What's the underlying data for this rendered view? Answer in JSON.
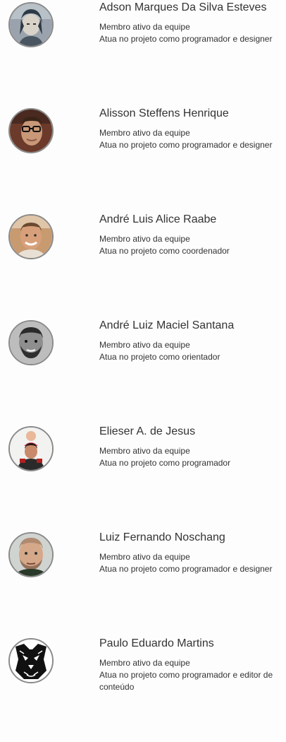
{
  "members": [
    {
      "name": "Adson Marques Da Silva Esteves",
      "status": "Membro ativo da equipe",
      "role": "Atua no projeto como programador e designer",
      "avatar_icon": "anime-avatar-icon"
    },
    {
      "name": "Alisson Steffens Henrique",
      "status": "Membro ativo da equipe",
      "role": "Atua no projeto como programador e designer",
      "avatar_icon": "person-glasses-avatar-icon"
    },
    {
      "name": "André Luis Alice Raabe",
      "status": "Membro ativo da equipe",
      "role": "Atua no projeto como coordenador",
      "avatar_icon": "person-avatar-icon"
    },
    {
      "name": "André Luiz Maciel Santana",
      "status": "Membro ativo da equipe",
      "role": "Atua no projeto como orientador",
      "avatar_icon": "person-bw-avatar-icon"
    },
    {
      "name": "Elieser A. de Jesus",
      "status": "Membro ativo da equipe",
      "role": "Atua no projeto como programador",
      "avatar_icon": "person-with-child-avatar-icon"
    },
    {
      "name": "Luiz Fernando Noschang",
      "status": "Membro ativo da equipe",
      "role": "Atua no projeto como programador e designer",
      "avatar_icon": "person-avatar-icon"
    },
    {
      "name": "Paulo Eduardo Martins",
      "status": "Membro ativo da equipe",
      "role": "Atua no projeto como programador e editor de conteúdo",
      "avatar_icon": "wolf-drawing-avatar-icon"
    }
  ]
}
